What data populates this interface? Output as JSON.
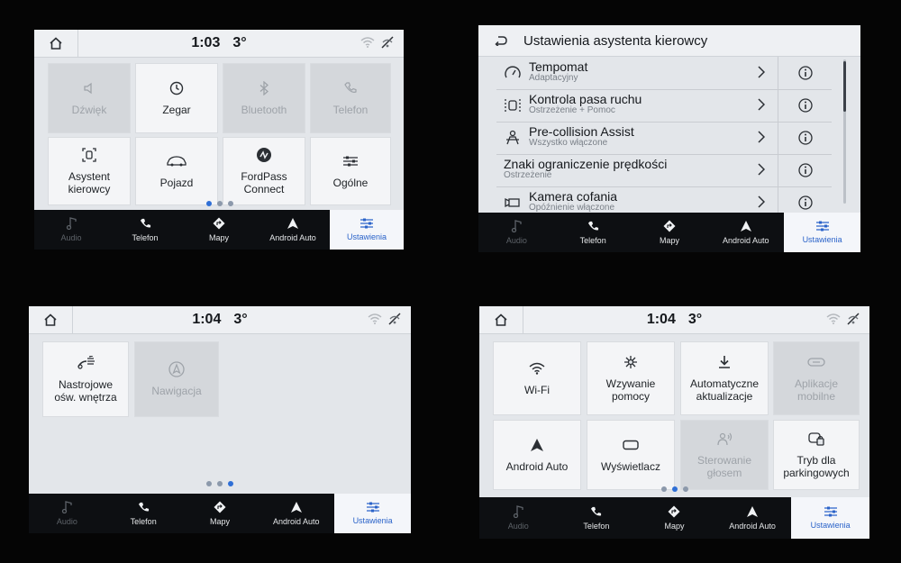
{
  "screens": {
    "a": {
      "status": {
        "time": "1:03",
        "temp": "3°"
      },
      "tiles": [
        {
          "label": "Dźwięk",
          "icon": "speaker-icon"
        },
        {
          "label": "Zegar",
          "icon": "clock-icon"
        },
        {
          "label": "Bluetooth",
          "icon": "bluetooth-icon"
        },
        {
          "label": "Telefon",
          "icon": "phone-icon"
        },
        {
          "label": "Asystent\nkierowcy",
          "icon": "driver-assist-icon"
        },
        {
          "label": "Pojazd",
          "icon": "car-icon"
        },
        {
          "label": "FordPass\nConnect",
          "icon": "fordpass-icon"
        },
        {
          "label": "Ogólne",
          "icon": "sliders-icon"
        }
      ]
    },
    "b": {
      "title": "Ustawienia asystenta kierowcy",
      "rows": [
        {
          "title": "Tempomat",
          "sub": "Adaptacyjny",
          "icon": "speedometer-icon"
        },
        {
          "title": "Kontrola pasa ruchu",
          "sub": "Ostrzeżenie + Pomoc",
          "icon": "lane-keep-icon"
        },
        {
          "title": "Pre-collision Assist",
          "sub": "Wszystko włączone",
          "icon": "pre-collision-icon"
        },
        {
          "title": "Znaki ograniczenie prędkości",
          "sub": "Ostrzeżenie",
          "icon": ""
        },
        {
          "title": "Kamera cofania",
          "sub": "Opóźnienie włączone",
          "icon": "camera-icon"
        }
      ]
    },
    "c": {
      "status": {
        "time": "1:04",
        "temp": "3°"
      },
      "tiles": [
        {
          "label": "Nastrojowe\nośw. wnętrza",
          "icon": "ambient-light-icon"
        },
        {
          "label": "Nawigacja",
          "icon": "navigation-icon"
        }
      ]
    },
    "d": {
      "status": {
        "time": "1:04",
        "temp": "3°"
      },
      "tiles": [
        {
          "label": "Wi-Fi",
          "icon": "wifi-icon"
        },
        {
          "label": "Wzywanie\npomocy",
          "icon": "assistance-icon"
        },
        {
          "label": "Automatyczne\naktualizacje",
          "icon": "download-icon"
        },
        {
          "label": "Aplikacje\nmobilne",
          "icon": "mobile-apps-icon"
        },
        {
          "label": "Android Auto",
          "icon": "android-auto-icon"
        },
        {
          "label": "Wyświetlacz",
          "icon": "display-icon"
        },
        {
          "label": "Sterowanie\ngłosem",
          "icon": "voice-icon"
        },
        {
          "label": "Tryb dla\nparkingowych",
          "icon": "valet-icon"
        }
      ]
    }
  },
  "nav": [
    {
      "label": "Audio",
      "icon": "music-note-icon"
    },
    {
      "label": "Telefon",
      "icon": "phone-icon"
    },
    {
      "label": "Mapy",
      "icon": "map-icon"
    },
    {
      "label": "Android Auto",
      "icon": "android-auto-icon"
    },
    {
      "label": "Ustawienia",
      "icon": "settings-sliders-icon"
    }
  ],
  "colors": {
    "accent": "#2a63c9",
    "nav_bg": "#0d0f12",
    "screen_bg": "#e3e6ea"
  }
}
